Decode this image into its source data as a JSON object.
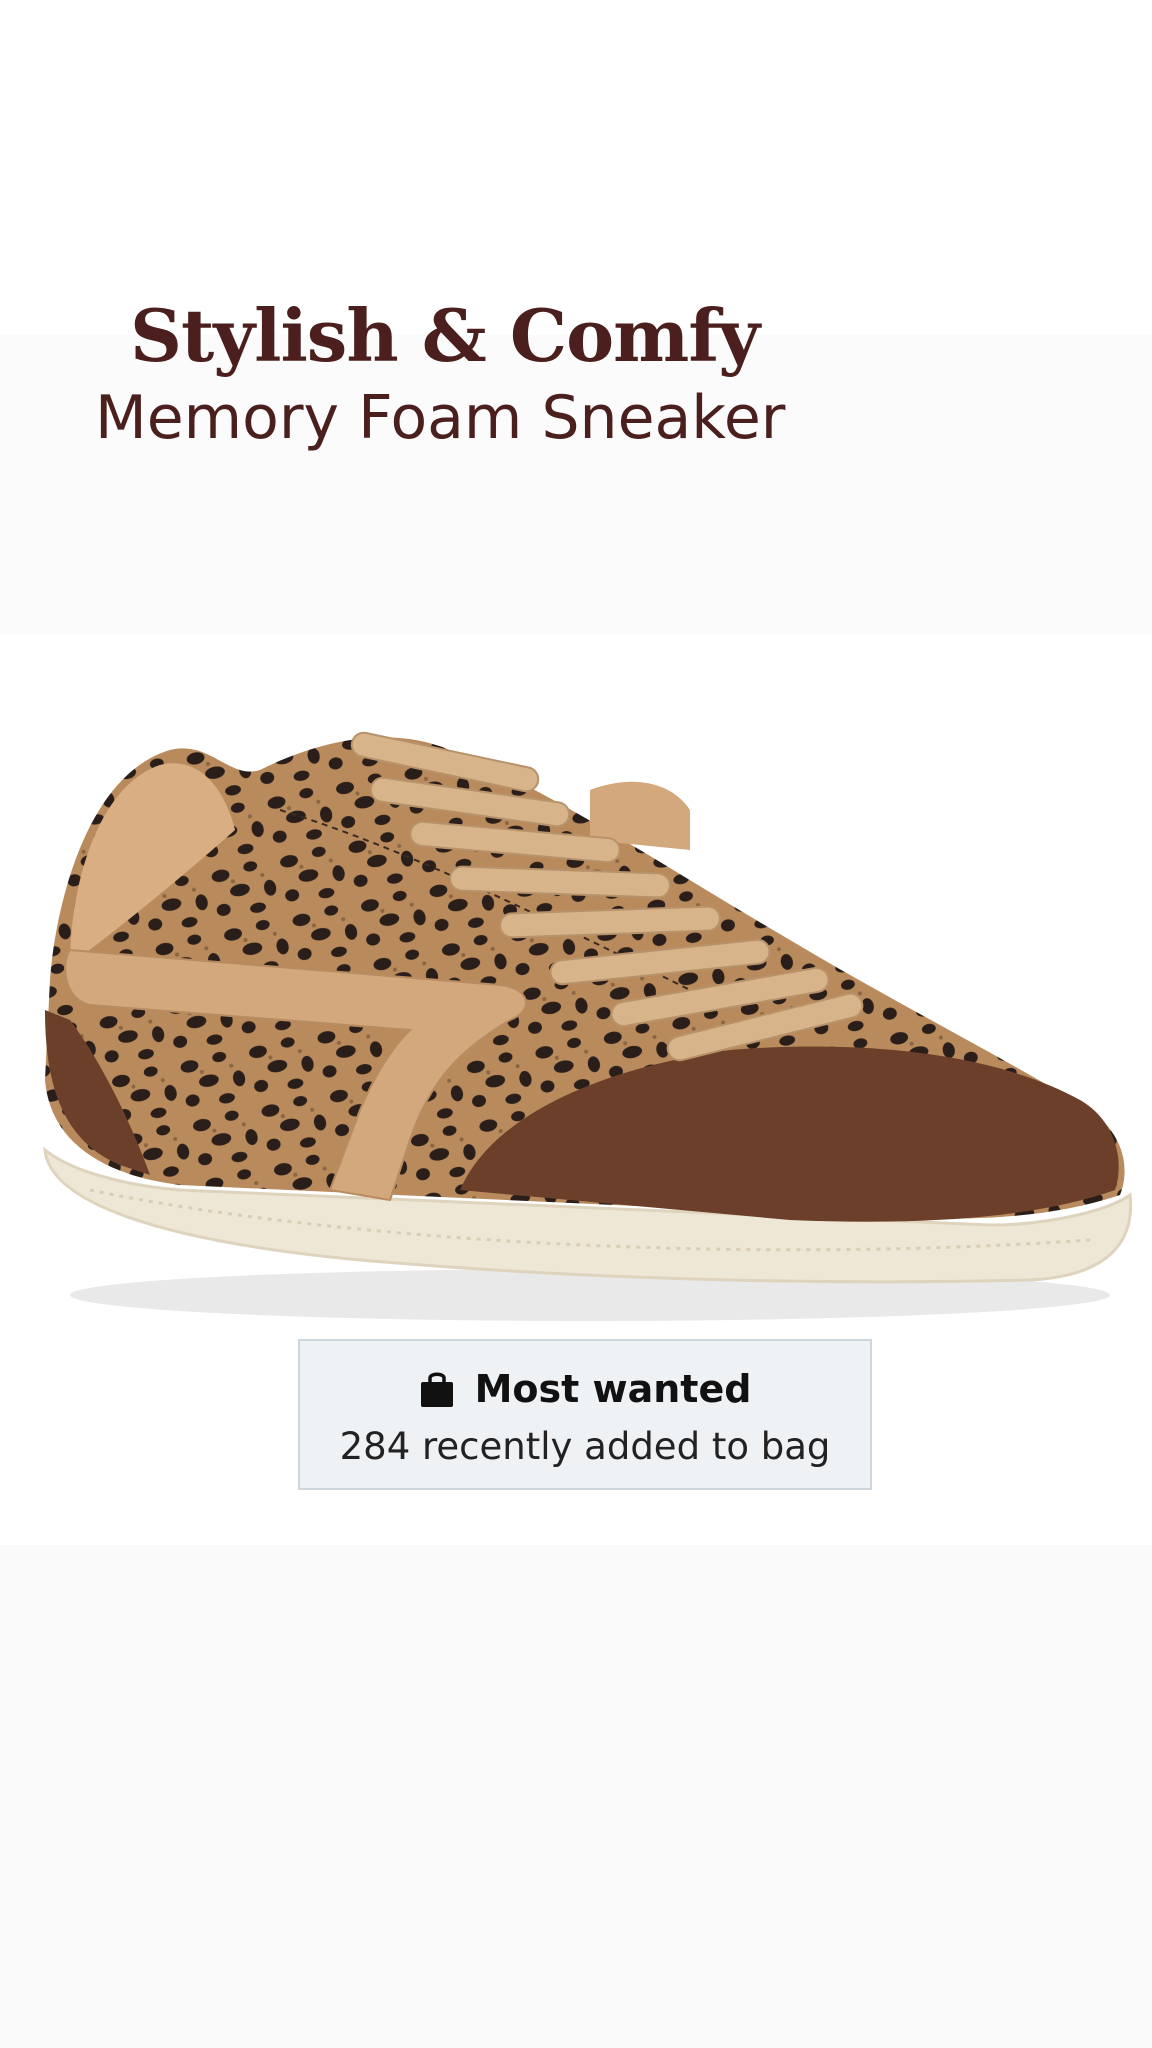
{
  "headline": {
    "title": "Stylish & Comfy",
    "subtitle": "Memory Foam Sneaker"
  },
  "product": {
    "image_alt": "leopard print sneaker with brown suede toe and tan laces",
    "colors": {
      "leopard_base": "#b98a5c",
      "spots": "#2a1e1a",
      "suede_toe": "#6b3f2a",
      "tan_overlay": "#d2a87c",
      "sole": "#efe7d6"
    }
  },
  "badge": {
    "icon": "shopping-bag-icon",
    "title": "Most wanted",
    "subtitle": "284 recently added to bag"
  },
  "colors": {
    "headline_text": "#4b1f1d",
    "badge_bg": "#eef2f5",
    "badge_border": "#cfd6db"
  }
}
